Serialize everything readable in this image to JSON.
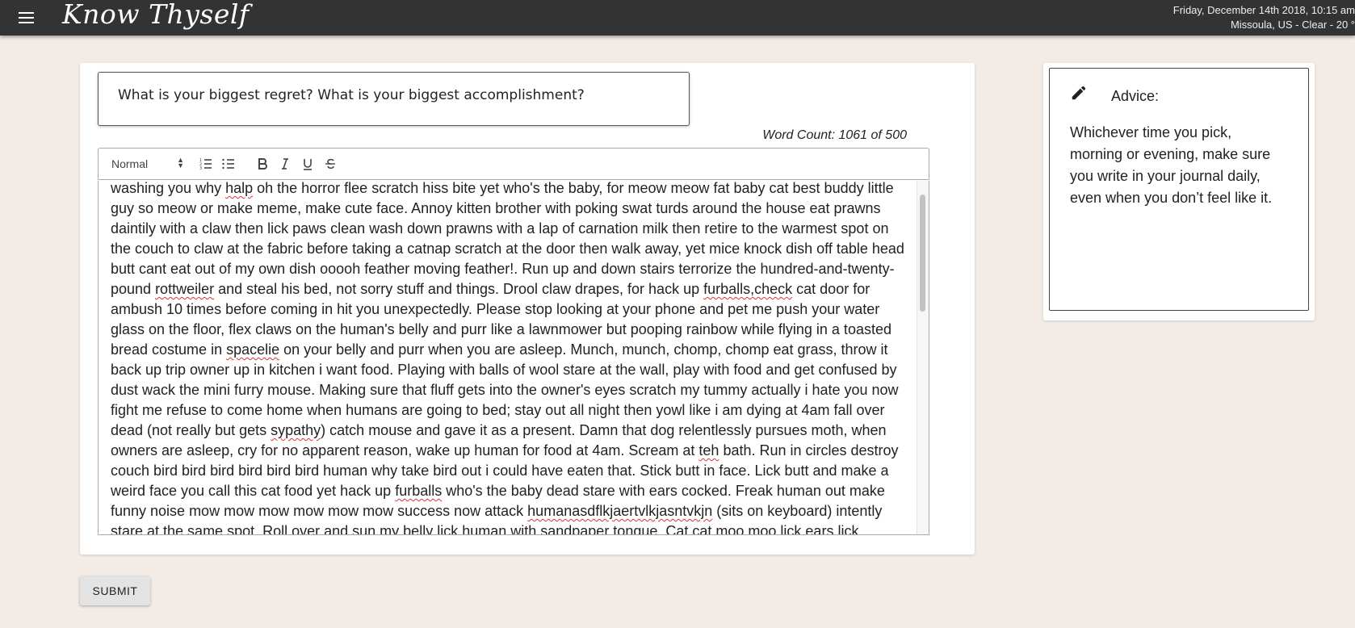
{
  "app": {
    "title": "Know Thyself",
    "datetime": "Friday, December 14th 2018, 10:15 am",
    "weather": "Missoula, US - Clear - 20 °"
  },
  "prompt": {
    "text": "What is your biggest regret? What is your biggest accomplishment?"
  },
  "word_count": "Word Count: 1061 of 500",
  "toolbar": {
    "format_select": "Normal",
    "buttons": [
      "ordered-list",
      "bullet-list",
      "bold",
      "italic",
      "underline",
      "strikethrough"
    ]
  },
  "editor": {
    "segments": [
      {
        "t": "washing you why "
      },
      {
        "t": "halp",
        "spell": true
      },
      {
        "t": " oh the horror flee scratch hiss bite yet who's the baby, for meow meow fat baby cat best buddy little guy so meow or make meme, make cute face. Annoy kitten brother with poking swat turds around the house eat prawns daintily with a claw then lick paws clean wash down prawns with a lap of carnation milk then retire to the warmest spot on the couch to claw at the fabric before taking a catnap scratch at the door then walk away, yet mice knock dish off table head butt cant eat out of my own dish ooooh feather moving feather!. Run up and down stairs terrorize the hundred-and-twenty-pound "
      },
      {
        "t": "rottweiler",
        "spell": true
      },
      {
        "t": " and steal his bed, not sorry stuff and things. Drool claw drapes, for hack up "
      },
      {
        "t": "furballs,check",
        "spell": true
      },
      {
        "t": " cat door for ambush 10 times before coming in hit you unexpectedly. Please stop looking at your phone and pet me push your water glass on the floor, flex claws on the human's belly and purr like a lawnmower but pooping rainbow while flying in a toasted bread costume in "
      },
      {
        "t": "spacelie",
        "spell": true
      },
      {
        "t": " on your belly and purr when you are asleep. Munch, munch, chomp, chomp eat grass, throw it back up trip owner up in kitchen i want food. Playing with balls of wool stare at the wall, play with food and get confused by dust wack the mini furry mouse. Making sure that fluff gets into the owner's eyes scratch my tummy actually i hate you now fight me refuse to come home when humans are going to bed; stay out all night then yowl like i am dying at 4am fall over dead (not really but gets "
      },
      {
        "t": "sypathy",
        "spell": true
      },
      {
        "t": ") catch mouse and gave it as a present. Damn that dog relentlessly pursues moth, when owners are asleep, cry for no apparent reason, wake up human for food at 4am. Scream at "
      },
      {
        "t": "teh",
        "spell": true
      },
      {
        "t": " bath. Run in circles destroy couch bird bird bird bird bird bird human why take bird out i could have eaten that. Stick butt in face. Lick butt and make a weird face you call this cat food yet hack up "
      },
      {
        "t": "furballs",
        "spell": true
      },
      {
        "t": " who's the baby dead stare with ears cocked. Freak human out make funny noise mow mow mow mow mow mow success now attack "
      },
      {
        "t": "humanasdflkjaertvlkjasntvkjn",
        "spell": true
      },
      {
        "t": " (sits on keyboard) intently stare at the same spot. Roll over and sun my belly lick human with sandpaper tongue. Cat cat moo moo lick ears lick"
      }
    ]
  },
  "submit_label": "SUBMIT",
  "advice": {
    "title": "Advice:",
    "text": "Whichever time you pick, morning or evening, make sure you write in your journal daily, even when you don’t feel like it."
  }
}
